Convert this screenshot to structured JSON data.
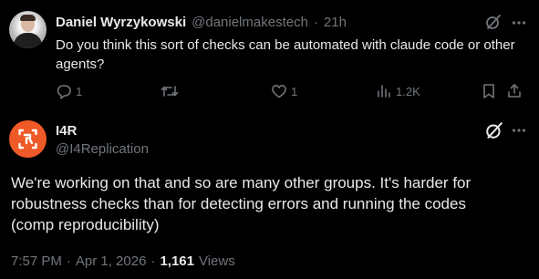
{
  "reply_tweet": {
    "author_name": "Daniel Wyrzykowski",
    "author_handle": "@danielmakestech",
    "separator": "·",
    "time_ago": "21h",
    "text": "Do you think this sort of checks can be automated with claude code or other agents?",
    "actions": {
      "replies": "1",
      "reposts": "",
      "likes": "1",
      "views": "1.2K"
    }
  },
  "main_tweet": {
    "author_name": "I4R",
    "author_handle": "@I4Replication",
    "text_lines": [
      "We're working on that and so are many other groups. It's harder for",
      "robustness checks than for detecting errors and running the codes",
      "(comp reproducibility)"
    ],
    "time": "7:57 PM",
    "separator": "·",
    "date": "Apr 1, 2026",
    "views_count": "1,161",
    "views_label": "Views"
  },
  "icons": {
    "reply": "reply-icon",
    "repost": "repost-icon",
    "like": "heart-icon",
    "views": "views-icon",
    "bookmark": "bookmark-icon",
    "share": "share-icon",
    "grok": "grok-icon",
    "more": "more-icon"
  },
  "colors": {
    "background": "#000000",
    "text": "#e7e9ea",
    "muted": "#71767b",
    "i4r_brand": "#f05a28"
  }
}
